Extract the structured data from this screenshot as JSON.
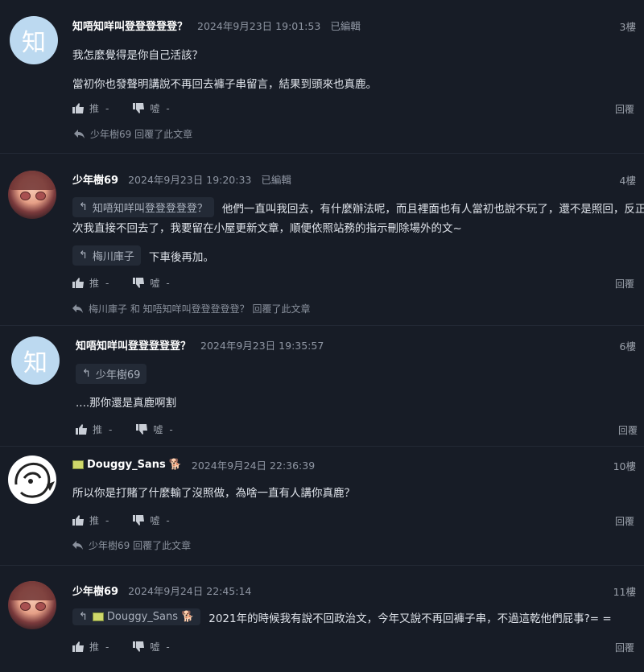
{
  "posts": [
    {
      "name": "知唔知咩叫登登登登登？",
      "date": "2024年9月23日 19:01:53",
      "edited": "已編輯",
      "floor": "3樓",
      "lines": [
        "我怎麼覺得是你自己活該？",
        "當初你也發聲明講說不再回去褲子串留言，結果到頭來也真鹿。"
      ],
      "replied_by": "少年樹69 回覆了此文章",
      "avatar_char": "知"
    },
    {
      "name": "少年樹69",
      "date": "2024年9月23日 19:20:33",
      "edited": "已編輯",
      "floor": "4樓",
      "quote1": "知唔知咩叫登登登登登？",
      "line1": "他們一直叫我回去，有什麼辦法呢，而且裡面也有人當初也說不玩了，還不是照回，反正這",
      "line2": "次我直接不回去了，我要留在小屋更新文章，順便依照站務的指示刪除場外的文~",
      "quote2": "梅川庫子",
      "line3": "下車後再加。",
      "replied_by": "梅川庫子 和 知唔知咩叫登登登登登？ 回覆了此文章"
    },
    {
      "name": "知唔知咩叫登登登登登？",
      "date": "2024年9月23日 19:35:57",
      "floor": "6樓",
      "quote1": "少年樹69",
      "line1": "....那你還是真鹿啊割",
      "avatar_char": "知"
    },
    {
      "name": "Douggy_Sans",
      "date": "2024年9月24日 22:36:39",
      "floor": "10樓",
      "line1": "所以你是打賭了什麼輸了沒照做，為啥一直有人講你真鹿？",
      "replied_by": "少年樹69 回覆了此文章"
    },
    {
      "name": "少年樹69",
      "date": "2024年9月24日 22:45:14",
      "floor": "11樓",
      "quote1": "Douggy_Sans",
      "line1": "2021年的時候我有說不回政治文，今年又說不再回褲子串，不過這乾他們屁事?= ="
    }
  ],
  "actions": {
    "up": "推",
    "down": "噓",
    "dash": "-",
    "reply": "回覆"
  }
}
